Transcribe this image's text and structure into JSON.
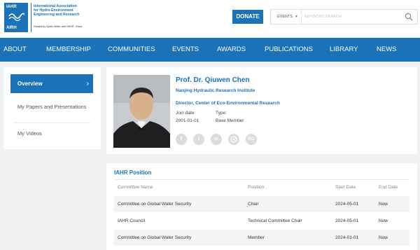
{
  "logo": {
    "abbr_top": "IAHR",
    "abbr_bottom": "AIRH",
    "org_name": "International Association for Hydro-Environment Engineering and Research",
    "hosted_by": "Hosted by Spain Water and IWHR, China"
  },
  "header": {
    "donate_label": "DONATE",
    "search_scope": "EVENTS",
    "search_placeholder": "KEYWORD SEARCH"
  },
  "nav": [
    "ABOUT",
    "MEMBERSHIP",
    "COMMUNITIES",
    "EVENTS",
    "AWARDS",
    "PUBLICATIONS",
    "LIBRARY",
    "NEWS"
  ],
  "sidebar": {
    "items": [
      {
        "label": "Overview"
      },
      {
        "label": "My Papers and Presentations"
      },
      {
        "label": "My Videos"
      }
    ]
  },
  "profile": {
    "name": "Prof. Dr. Qiuwen Chen",
    "institute": "Nanjing Hydraulic Research Institute",
    "role": "Director, Center of Eco-Environmental Research",
    "join_date_label": "Join date:",
    "join_date": "2001-01-01",
    "type_label": "Type:",
    "type": "Base Member",
    "social": [
      "f",
      "t",
      "in",
      "wechat",
      "RG"
    ]
  },
  "positions": {
    "title": "IAHR Position",
    "columns": [
      "Committee Name",
      "Position",
      "Start Date",
      "End Date"
    ],
    "rows": [
      [
        "Committee on Global Water Security",
        "Chair",
        "2024-05-01",
        "Now"
      ],
      [
        "IAHR Council",
        "Technical Committee Chair",
        "2024-05-01",
        "Now"
      ],
      [
        "Committee on Global Water Security",
        "Member",
        "2024-01-01",
        "Now"
      ]
    ]
  },
  "colors": {
    "brand": "#1a72b8",
    "background": "#f0f1f3"
  }
}
